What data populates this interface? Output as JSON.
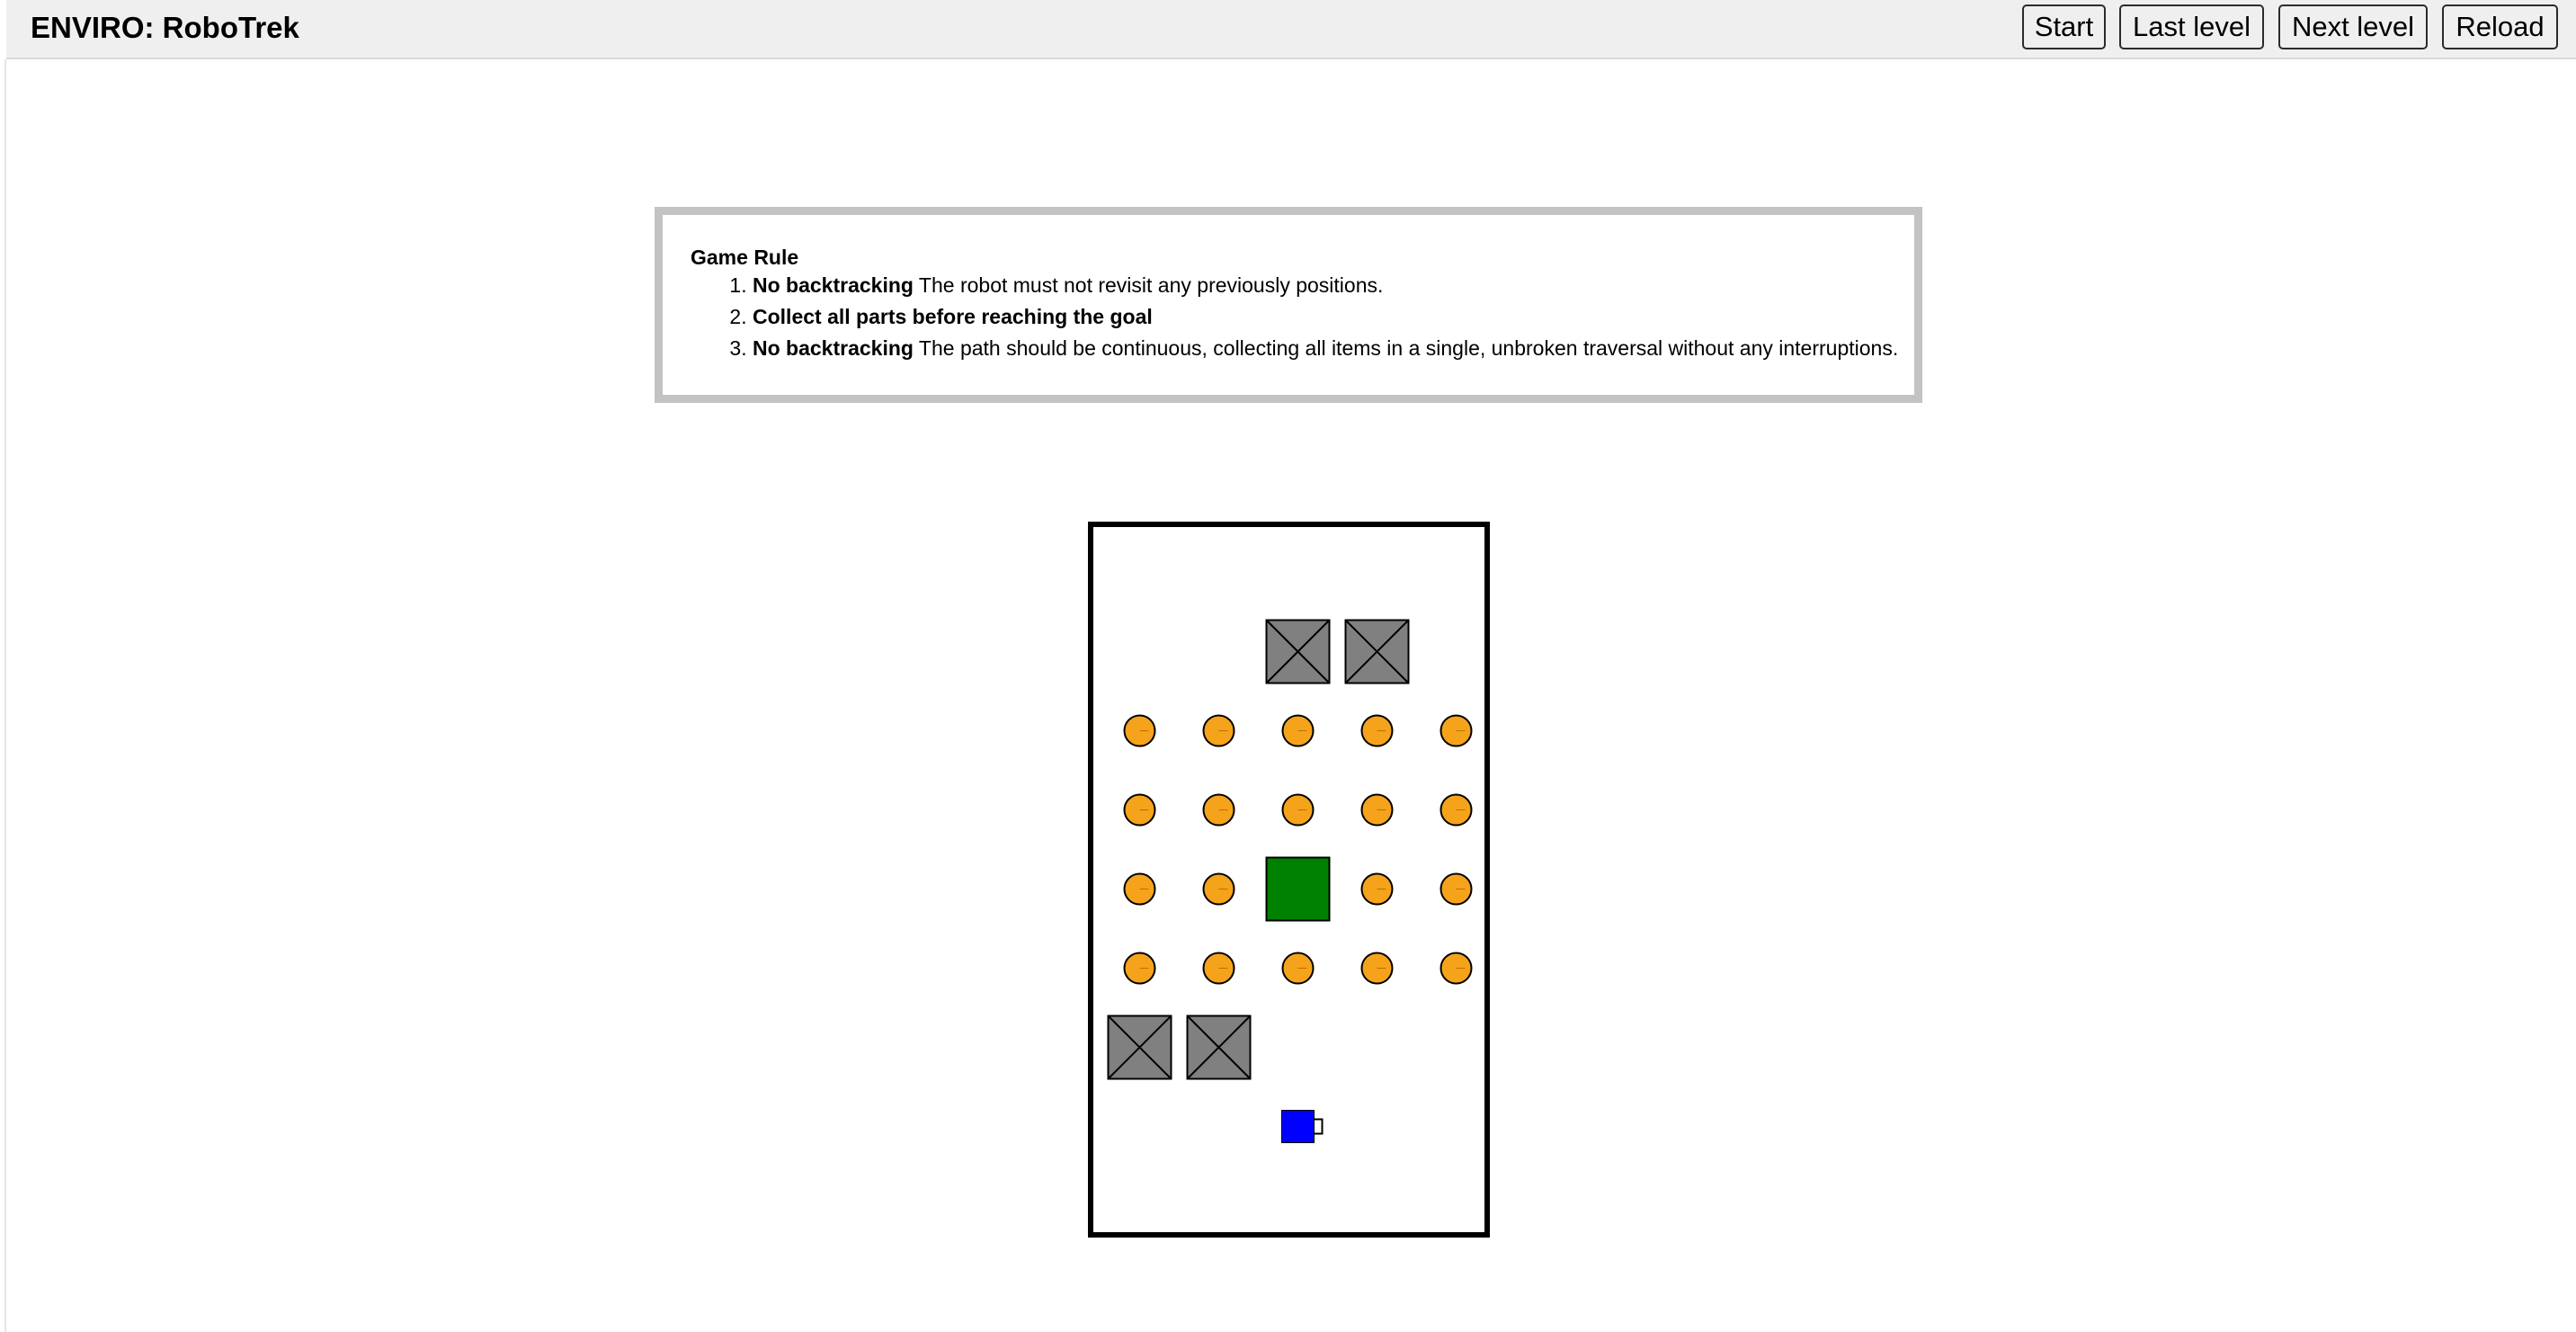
{
  "app": {
    "title": "ENVIRO: RoboTrek"
  },
  "toolbar": {
    "start_label": "Start",
    "last_level_label": "Last level",
    "next_level_label": "Next level",
    "reload_label": "Reload"
  },
  "rules": {
    "title": "Game Rule",
    "items": [
      {
        "bold": "No backtracking",
        "text": " The robot must not revisit any previously positions."
      },
      {
        "bold": "Collect all parts before reaching the goal",
        "text": ""
      },
      {
        "bold": "No backtracking",
        "text": " The path should be continuous, collecting all items in a single, unbroken traversal without any interruptions."
      }
    ]
  },
  "board": {
    "cols": 5,
    "rows": 9,
    "colors": {
      "part": "#f5a31a",
      "goal": "#008000",
      "obstacle": "#808080",
      "robot": "#0000ff",
      "wall": "#000000"
    },
    "obstacles": [
      [
        1,
        2
      ],
      [
        1,
        3
      ],
      [
        6,
        0
      ],
      [
        6,
        1
      ]
    ],
    "goal": [
      4,
      2
    ],
    "robot": {
      "cell": [
        7,
        2
      ],
      "facing": "right"
    },
    "parts": [
      [
        2,
        0
      ],
      [
        2,
        1
      ],
      [
        2,
        2
      ],
      [
        2,
        3
      ],
      [
        2,
        4
      ],
      [
        3,
        0
      ],
      [
        3,
        1
      ],
      [
        3,
        2
      ],
      [
        3,
        3
      ],
      [
        3,
        4
      ],
      [
        4,
        0
      ],
      [
        4,
        1
      ],
      [
        4,
        3
      ],
      [
        4,
        4
      ],
      [
        5,
        0
      ],
      [
        5,
        1
      ],
      [
        5,
        2
      ],
      [
        5,
        3
      ],
      [
        5,
        4
      ]
    ]
  }
}
